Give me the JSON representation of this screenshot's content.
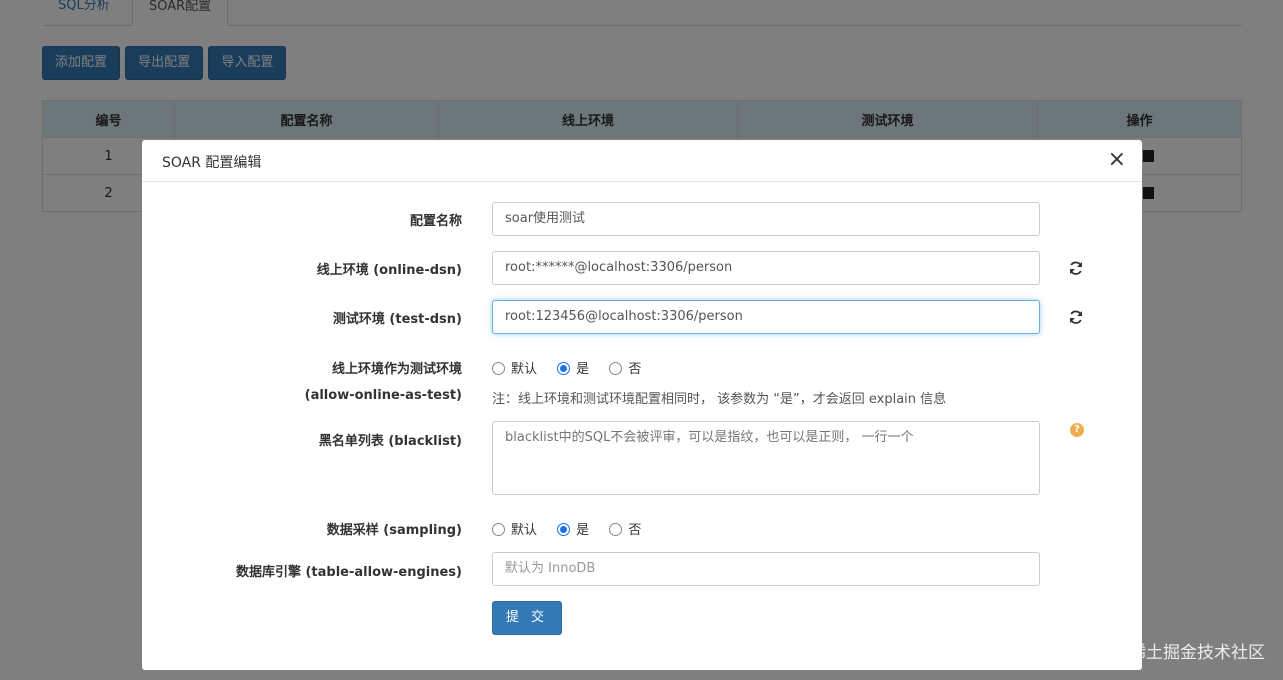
{
  "tabs": [
    "SQL分析",
    "SOAR配置"
  ],
  "actions": [
    "添加配置",
    "导出配置",
    "导入配置"
  ],
  "table": {
    "headers": [
      "编号",
      "配置名称",
      "线上环境",
      "测试环境",
      "操作"
    ],
    "rows": [
      [
        "1"
      ],
      [
        "2"
      ]
    ]
  },
  "modal": {
    "title": "SOAR 配置编辑",
    "close": "×",
    "fields": {
      "name": {
        "label": "配置名称",
        "value": "soar使用测试"
      },
      "online": {
        "label": "线上环境 (online-dsn)",
        "value": "root:******@localhost:3306/person"
      },
      "test": {
        "label": "测试环境 (test-dsn)",
        "value": "root:123456@localhost:3306/person"
      },
      "allow": {
        "label1": "线上环境作为测试环境",
        "label2": "(allow-online-as-test)",
        "options": [
          "默认",
          "是",
          "否"
        ],
        "selected": "是"
      },
      "note": "注：线上环境和测试环境配置相同时， 该参数为 “是”，才会返回 explain 信息",
      "blacklist": {
        "label": "黑名单列表 (blacklist)",
        "placeholder": "blacklist中的SQL不会被评审，可以是指纹，也可以是正则， 一行一个"
      },
      "sampling": {
        "label": "数据采样 (sampling)",
        "options": [
          "默认",
          "是",
          "否"
        ],
        "selected": "是"
      },
      "engines": {
        "label": "数据库引擎 (table-allow-engines)",
        "placeholder": "默认为 InnoDB"
      }
    },
    "submit": "提 交"
  },
  "watermark": "@稀土掘金技术社区",
  "colors": {
    "primary": "#337ab7",
    "header_bg": "#d9edf7",
    "help": "#f0ad4e",
    "radio": "#1a73e8"
  }
}
